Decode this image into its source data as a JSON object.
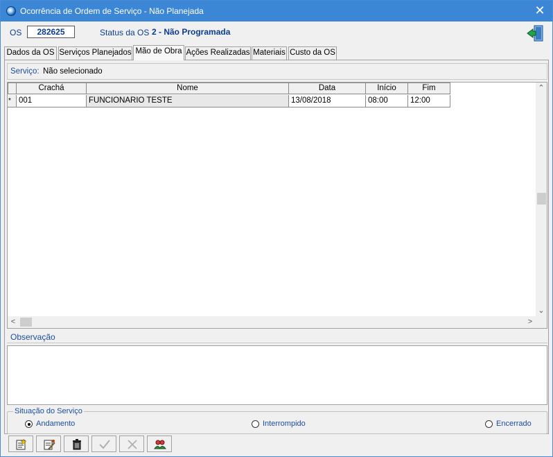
{
  "window": {
    "title": "Ocorrência de Ordem de Serviço - Não Planejada",
    "close_glyph": "✕"
  },
  "header": {
    "os_label": "OS",
    "os_value": "282625",
    "status_label": "Status da OS",
    "status_value": "2 - Não Programada"
  },
  "tabs": [
    {
      "label": "Dados da OS"
    },
    {
      "label": "Serviços Planejados"
    },
    {
      "label": "Mão de Obra",
      "active": true
    },
    {
      "label": "Ações Realizadas"
    },
    {
      "label": "Materiais"
    },
    {
      "label": "Custo da OS"
    }
  ],
  "servico": {
    "label": "Serviço:",
    "value": "Não selecionado"
  },
  "grid": {
    "columns": [
      "Crachá",
      "Nome",
      "Data",
      "Início",
      "Fim"
    ],
    "rows": [
      {
        "marker": "*",
        "cracha": "001",
        "nome": "FUNCIONARIO TESTE",
        "data": "13/08/2018",
        "inicio": "08:00",
        "fim": "12:00"
      }
    ]
  },
  "observacao": {
    "label": "Observação",
    "value": ""
  },
  "situacao": {
    "legend": "Situação do Serviço",
    "options": [
      {
        "label": "Andamento",
        "selected": true
      },
      {
        "label": "Interrompido",
        "selected": false
      },
      {
        "label": "Encerrado",
        "selected": false
      }
    ]
  },
  "toolbar": {
    "buttons": [
      {
        "icon": "new-record-icon"
      },
      {
        "icon": "edit-record-icon"
      },
      {
        "icon": "trash-icon"
      },
      {
        "icon": "checkmark-icon"
      },
      {
        "icon": "cancel-x-icon"
      },
      {
        "icon": "people-search-icon"
      }
    ]
  },
  "colors": {
    "titlebar": "#3c86d6",
    "label_blue": "#1a4c9c",
    "os_blue": "#0b3d91"
  }
}
